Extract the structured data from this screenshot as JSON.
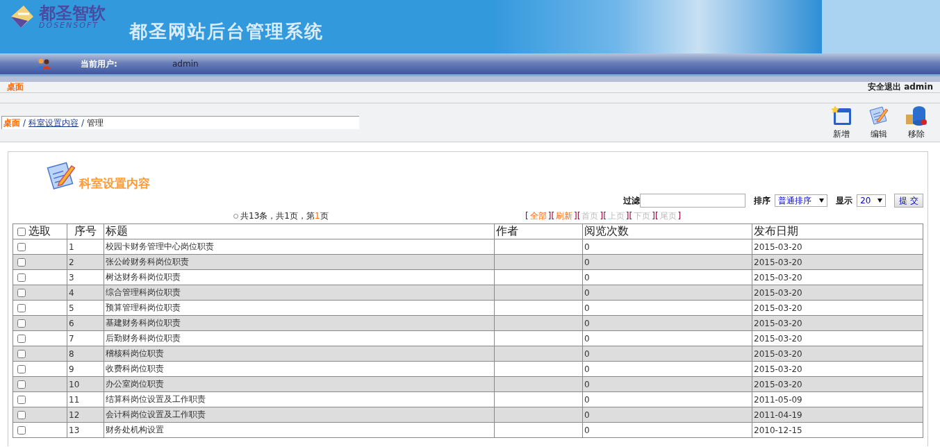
{
  "header": {
    "logo_cn": "都圣智软",
    "logo_en": "DOSENSOFT",
    "title": "都圣网站后台管理系统"
  },
  "user_bar": {
    "label": "当前用户:",
    "user": "admin"
  },
  "tab_bar": {
    "tab": "桌面",
    "logout": "安全退出",
    "user": "admin"
  },
  "breadcrumb": [
    {
      "label": "桌面",
      "kind": "home",
      "sep": "/"
    },
    {
      "label": "科室设置内容",
      "kind": "link",
      "sep": "/"
    },
    {
      "label": "管理",
      "kind": "text"
    }
  ],
  "toolbar": [
    {
      "label": "新增",
      "kind": "new"
    },
    {
      "label": "编辑",
      "kind": "edit"
    },
    {
      "label": "移除",
      "kind": "remove"
    }
  ],
  "panel": {
    "title": "科室设置内容"
  },
  "filter": {
    "label": "过滤",
    "sort_label": "排序",
    "sort_value": "普通排序",
    "show_label": "显示",
    "show_value": "20",
    "submit": "提 交"
  },
  "page_info": {
    "prefix": "共13条，共1页，第",
    "current": "1",
    "suffix": "页"
  },
  "pager": [
    {
      "label": "全部",
      "disabled": false,
      "left": "[",
      "right": "]"
    },
    {
      "label": "刷新",
      "disabled": false,
      "left": "[",
      "right": "]"
    },
    {
      "label": "首页",
      "disabled": true,
      "left": "[",
      "right": "]"
    },
    {
      "label": "上页",
      "disabled": true,
      "left": "[",
      "right": "]"
    },
    {
      "label": "下页",
      "disabled": true,
      "left": "[",
      "right": "]"
    },
    {
      "label": "尾页",
      "disabled": true,
      "left": "[",
      "right": "]"
    }
  ],
  "table": {
    "select_all_checked": false,
    "columns": [
      "选取",
      "序号",
      "标题",
      "作者",
      "阅览次数",
      "发布日期"
    ],
    "rows": [
      {
        "checked": false,
        "no": "1",
        "title": "校园卡财务管理中心岗位职责",
        "views": "0",
        "date": "2015-03-20"
      },
      {
        "checked": false,
        "no": "2",
        "title": "张公岭财务科岗位职责",
        "views": "0",
        "date": "2015-03-20"
      },
      {
        "checked": false,
        "no": "3",
        "title": "树达财务科岗位职责",
        "views": "0",
        "date": "2015-03-20"
      },
      {
        "checked": false,
        "no": "4",
        "title": "综合管理科岗位职责",
        "views": "0",
        "date": "2015-03-20"
      },
      {
        "checked": false,
        "no": "5",
        "title": "预算管理科岗位职责",
        "views": "0",
        "date": "2015-03-20"
      },
      {
        "checked": false,
        "no": "6",
        "title": "基建财务科岗位职责",
        "views": "0",
        "date": "2015-03-20"
      },
      {
        "checked": false,
        "no": "7",
        "title": "后勤财务科岗位职责",
        "views": "0",
        "date": "2015-03-20"
      },
      {
        "checked": false,
        "no": "8",
        "title": "稽核科岗位职责",
        "views": "0",
        "date": "2015-03-20"
      },
      {
        "checked": false,
        "no": "9",
        "title": "收费科岗位职责",
        "views": "0",
        "date": "2015-03-20"
      },
      {
        "checked": false,
        "no": "10",
        "title": "办公室岗位职责",
        "views": "0",
        "date": "2015-03-20"
      },
      {
        "checked": false,
        "no": "11",
        "title": "结算科岗位设置及工作职责",
        "views": "0",
        "date": "2011-05-09"
      },
      {
        "checked": false,
        "no": "12",
        "title": "会计科岗位设置及工作职责",
        "views": "0",
        "date": "2011-04-19"
      },
      {
        "checked": false,
        "no": "13",
        "title": "财务处机构设置",
        "views": "0",
        "date": "2010-12-15"
      }
    ]
  }
}
